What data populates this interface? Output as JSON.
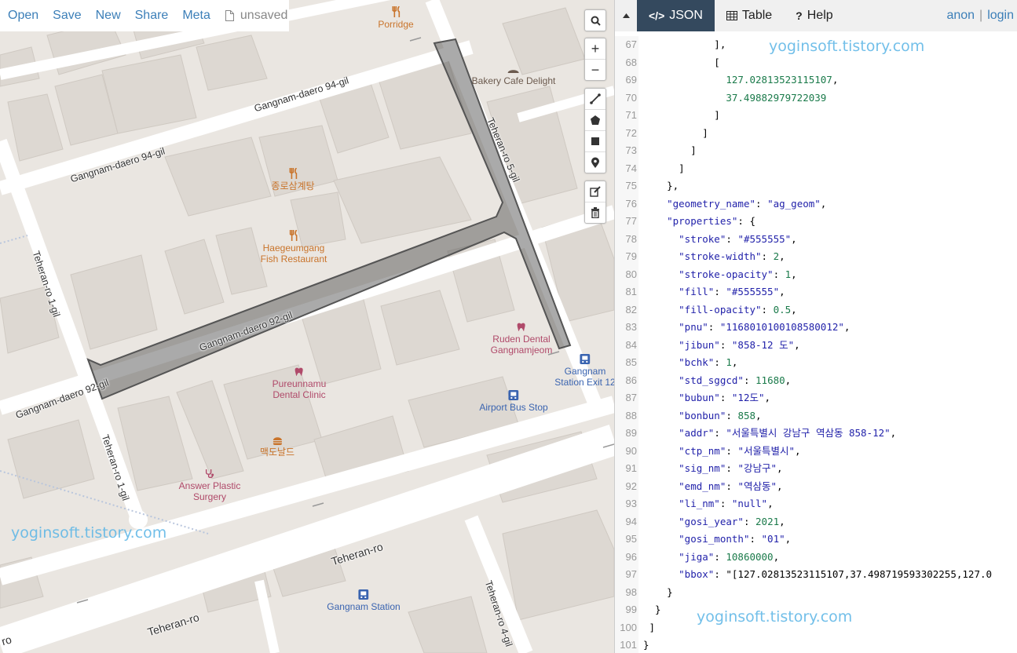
{
  "toolbar": {
    "open": "Open",
    "save": "Save",
    "new": "New",
    "share": "Share",
    "meta": "Meta",
    "status": "unsaved"
  },
  "map_controls": {
    "zoom_in": "+",
    "zoom_out": "−"
  },
  "pois": {
    "porridge": "Porridge",
    "bakery": "Bakery Cafe Delight",
    "jongno": "종로삼계탕",
    "haegeumgang_1": "Haegeumgang",
    "haegeumgang_2": "Fish Restaurant",
    "ruden_1": "Ruden Dental",
    "ruden_2": "Gangnamjeom",
    "exit_1": "Gangnam",
    "exit_2": "Station Exit 12",
    "airport": "Airport Bus Stop",
    "pureun_1": "Pureunnamu",
    "pureun_2": "Dental Clinic",
    "mcd": "맥도날드",
    "answer_1": "Answer Plastic",
    "answer_2": "Surgery",
    "gangnam_station": "Gangnam Station"
  },
  "streets": {
    "s94a": "Gangnam-daero 94-gil",
    "s94b": "Gangnam-daero 94-gil",
    "s92a": "Gangnam-daero 92-gil",
    "s92b": "Gangnam-daero 92-gil",
    "t5": "Teheran-ro 5-gil",
    "t1a": "Teheran-ro 1-gil",
    "t1b": "Teheran-ro 1-gil",
    "tr1": "Teheran-ro",
    "tr2": "Teheran-ro",
    "t4": "Teheran-ro 4-gil",
    "ro": "ro"
  },
  "watermark": "yoginsoft.tistory.com",
  "panel": {
    "tabs": {
      "json": "JSON",
      "table": "Table",
      "help": "Help"
    },
    "auth": {
      "anon": "anon",
      "login": "login"
    }
  },
  "code_lines": [
    {
      "n": "67",
      "t": "            ],"
    },
    {
      "n": "68",
      "t": "            ["
    },
    {
      "n": "69",
      "t": "              127.02813523115107,"
    },
    {
      "n": "70",
      "t": "              37.49882979722039"
    },
    {
      "n": "71",
      "t": "            ]"
    },
    {
      "n": "72",
      "t": "          ]"
    },
    {
      "n": "73",
      "t": "        ]"
    },
    {
      "n": "74",
      "t": "      ]"
    },
    {
      "n": "75",
      "t": "    },"
    },
    {
      "n": "76",
      "t": "    \"geometry_name\": \"ag_geom\","
    },
    {
      "n": "77",
      "t": "    \"properties\": {"
    },
    {
      "n": "78",
      "t": "      \"stroke\": \"#555555\","
    },
    {
      "n": "79",
      "t": "      \"stroke-width\": 2,"
    },
    {
      "n": "80",
      "t": "      \"stroke-opacity\": 1,"
    },
    {
      "n": "81",
      "t": "      \"fill\": \"#555555\","
    },
    {
      "n": "82",
      "t": "      \"fill-opacity\": 0.5,"
    },
    {
      "n": "83",
      "t": "      \"pnu\": \"1168010100108580012\","
    },
    {
      "n": "84",
      "t": "      \"jibun\": \"858-12 도\","
    },
    {
      "n": "85",
      "t": "      \"bchk\": 1,"
    },
    {
      "n": "86",
      "t": "      \"std_sggcd\": 11680,"
    },
    {
      "n": "87",
      "t": "      \"bubun\": \"12도\","
    },
    {
      "n": "88",
      "t": "      \"bonbun\": 858,"
    },
    {
      "n": "89",
      "t": "      \"addr\": \"서울특별시 강남구 역삼동 858-12\","
    },
    {
      "n": "90",
      "t": "      \"ctp_nm\": \"서울특별시\","
    },
    {
      "n": "91",
      "t": "      \"sig_nm\": \"강남구\","
    },
    {
      "n": "92",
      "t": "      \"emd_nm\": \"역삼동\","
    },
    {
      "n": "93",
      "t": "      \"li_nm\": \"null\","
    },
    {
      "n": "94",
      "t": "      \"gosi_year\": 2021,"
    },
    {
      "n": "95",
      "t": "      \"gosi_month\": \"01\","
    },
    {
      "n": "96",
      "t": "      \"jiga\": 10860000,"
    },
    {
      "n": "97",
      "t": "      \"bbox\": \"[127.02813523115107,37.498719593302255,127.0"
    },
    {
      "n": "98",
      "t": "    }"
    },
    {
      "n": "99",
      "t": "  }"
    },
    {
      "n": "100",
      "t": " ]"
    },
    {
      "n": "101",
      "t": "}"
    }
  ],
  "colors": {
    "accent": "#3c7fb8",
    "active_tab": "#34495e",
    "polygon": "#555555"
  }
}
